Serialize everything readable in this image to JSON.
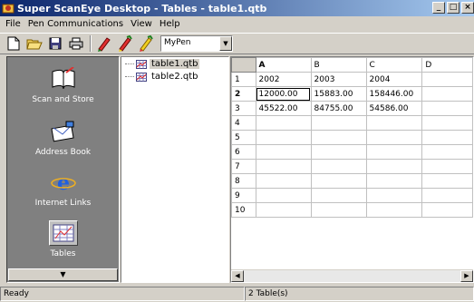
{
  "window": {
    "title": "Super ScanEye Desktop - Tables - table1.qtb",
    "minimize": "_",
    "maximize": "□",
    "close": "×"
  },
  "menu": [
    "File",
    "Pen Communications",
    "View",
    "Help"
  ],
  "toolbar": {
    "pen_select": "MyPen",
    "icons": [
      "new-icon",
      "open-icon",
      "save-icon",
      "print-icon",
      "pen-red-icon",
      "pen-green-icon",
      "pen-yellow-icon"
    ]
  },
  "shortcuts": [
    {
      "label": "Scan and Store",
      "icon": "scan-book-icon"
    },
    {
      "label": "Address Book",
      "icon": "address-book-icon"
    },
    {
      "label": "Internet Links",
      "icon": "internet-links-icon"
    },
    {
      "label": "Tables",
      "icon": "tables-icon",
      "selected": true
    }
  ],
  "tree": [
    {
      "label": "table1.qtb",
      "selected": true
    },
    {
      "label": "table2.qtb",
      "selected": false
    }
  ],
  "grid": {
    "columns": [
      "A",
      "B",
      "C",
      "D"
    ],
    "rows": [
      {
        "n": "1",
        "cells": [
          "2002",
          "2003",
          "2004",
          ""
        ]
      },
      {
        "n": "2",
        "cells": [
          "12000.00",
          "15883.00",
          "158446.00",
          ""
        ]
      },
      {
        "n": "3",
        "cells": [
          "45522.00",
          "84755.00",
          "54586.00",
          ""
        ]
      },
      {
        "n": "4",
        "cells": [
          "",
          "",
          "",
          ""
        ]
      },
      {
        "n": "5",
        "cells": [
          "",
          "",
          "",
          ""
        ]
      },
      {
        "n": "6",
        "cells": [
          "",
          "",
          "",
          ""
        ]
      },
      {
        "n": "7",
        "cells": [
          "",
          "",
          "",
          ""
        ]
      },
      {
        "n": "8",
        "cells": [
          "",
          "",
          "",
          ""
        ]
      },
      {
        "n": "9",
        "cells": [
          "",
          "",
          "",
          ""
        ]
      },
      {
        "n": "10",
        "cells": [
          "",
          "",
          "",
          ""
        ]
      }
    ],
    "active_row": 1,
    "active_col": 0
  },
  "status": {
    "left": "Ready",
    "right": "2 Table(s)"
  }
}
